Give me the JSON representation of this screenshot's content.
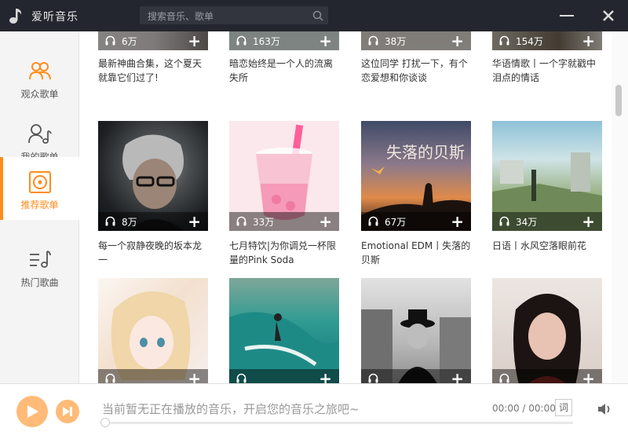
{
  "app": {
    "title": "爱听音乐"
  },
  "search": {
    "placeholder": "搜索音乐、歌单"
  },
  "sidebar": {
    "items": [
      {
        "label": "观众歌单",
        "icon": "users-icon",
        "active": false
      },
      {
        "label": "我的歌单",
        "icon": "user-music-icon",
        "active": false
      },
      {
        "label": "推荐歌单",
        "icon": "recommend-disc-icon",
        "active": true
      },
      {
        "label": "热门歌曲",
        "icon": "hot-songs-icon",
        "active": false
      }
    ]
  },
  "playlists": [
    {
      "plays": "6万",
      "title": "最新神曲合集，这个夏天就靠它们过了!"
    },
    {
      "plays": "163万",
      "title": "暗恋始终是一个人的流离失所"
    },
    {
      "plays": "38万",
      "title": "这位同学 打扰一下，有个恋爱想和你谈谈"
    },
    {
      "plays": "154万",
      "title": "华语情歌丨一个字就戳中泪点的情话"
    },
    {
      "plays": "8万",
      "title": "每一个寂静夜晚的坂本龙一"
    },
    {
      "plays": "33万",
      "title": "七月特饮|为你调兑一杯限量的Pink Soda"
    },
    {
      "plays": "67万",
      "title": "Emotional EDM丨失落的贝斯",
      "cover_text": "失落的贝斯"
    },
    {
      "plays": "34万",
      "title": "日语丨水风空落眼前花"
    },
    {
      "plays": "",
      "title": ""
    },
    {
      "plays": "",
      "title": ""
    },
    {
      "plays": "",
      "title": ""
    },
    {
      "plays": "",
      "title": ""
    }
  ],
  "player": {
    "status": "当前暂无正在播放的音乐，开启您的音乐之旅吧~",
    "time": "00:00 / 00:00",
    "lyrics_label": "词",
    "progress": 0
  },
  "colors": {
    "accent": "#ff8c1a",
    "titlebar": "#24262f",
    "button": "#ffbb77"
  }
}
